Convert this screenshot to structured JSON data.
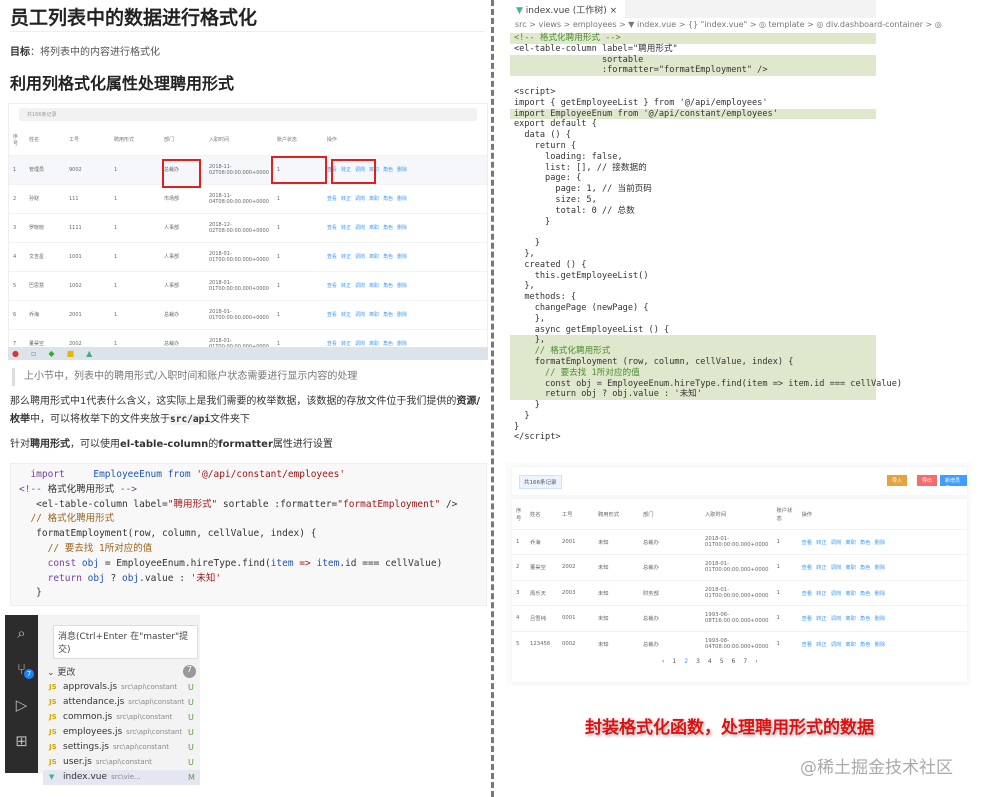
{
  "article": {
    "title": "员工列表中的数据进行格式化",
    "goal_label": "目标",
    "goal_text": "：将列表中的内容进行格式化",
    "subtitle": "利用列格式化属性处理聘用形式",
    "quote": "上小节中，列表中的聘用形式/入职时间和账户状态需要进行显示内容的处理",
    "para1_a": "那么聘用形式中1代表什么含义，这实际上是我们需要的枚举数据，该数据的存放文件位于我们提供的",
    "para1_b": "资源/枚举",
    "para1_c": "中，可以将枚举下的文件夹放于",
    "para1_code": "src/api",
    "para1_d": "文件夹下",
    "para2_a": "针对",
    "para2_b": "聘用形式",
    "para2_c": "，可以使用",
    "para2_d": "el-table-column",
    "para2_e": "的",
    "para2_f": "formatter",
    "para2_g": "属性进行设置"
  },
  "left_table": {
    "record_text": "共166条记录",
    "headers": [
      "序号",
      "姓名",
      "工号",
      "聘用形式",
      "部门",
      "入职时间",
      "账户状态",
      "操作"
    ],
    "rows": [
      [
        "1",
        "管理员",
        "9002",
        "1",
        "总裁办",
        "2018-11-02T08:00:00.000+0000",
        "1"
      ],
      [
        "2",
        "孙财",
        "111",
        "1",
        "市场部",
        "2018-11-04T08:00:00.000+0000",
        "1"
      ],
      [
        "3",
        "罗晓晓",
        "1111",
        "1",
        "人事部",
        "2018-12-02T08:00:00.000+0000",
        "1"
      ],
      [
        "4",
        "文吉星",
        "1001",
        "1",
        "人事部",
        "2018-01-01T00:00:00.000+0000",
        "1"
      ],
      [
        "5",
        "巴思慧",
        "1002",
        "1",
        "人事部",
        "2018-01-01T00:00:00.000+0000",
        "1"
      ],
      [
        "6",
        "乔海",
        "2001",
        "1",
        "总裁办",
        "2018-01-01T00:00:00.000+0000",
        "1"
      ],
      [
        "7",
        "董昊空",
        "2002",
        "1",
        "总裁办",
        "2018-01-01T00:00:00.000+0000",
        "1"
      ]
    ],
    "ops": [
      "查看",
      "转正",
      "调岗",
      "离职",
      "角色",
      "删除"
    ]
  },
  "code_block": [
    [
      [
        "  import     ",
        "kw"
      ],
      [
        "EmployeeEnum ",
        "bl"
      ],
      [
        "from ",
        "bl"
      ],
      [
        "'@/api/constant/employees'",
        "st"
      ]
    ],
    [
      [
        "<!-- ",
        "tg"
      ],
      [
        "格式化聘用形式",
        "fn"
      ],
      [
        " -->",
        "tg"
      ]
    ],
    [
      [
        "   <el-table-column label=",
        "fn"
      ],
      [
        "\"聘用形式\"",
        "st"
      ],
      [
        " sortable :formatter=",
        "fn"
      ],
      [
        "\"formatEmployment\"",
        "st"
      ],
      [
        " />",
        "fn"
      ]
    ],
    [
      [
        "  // 格式化聘用形式",
        "cm"
      ]
    ],
    [
      [
        "   formatEmployment(row, column, cellValue, index) {",
        "fn"
      ]
    ],
    [
      [
        "     // 要去找 1所对应的值",
        "cm"
      ]
    ],
    [
      [
        "     const ",
        "kw"
      ],
      [
        "obj",
        "bl"
      ],
      [
        " = EmployeeEnum.hireType.find(",
        "fn"
      ],
      [
        "item",
        "bl"
      ],
      [
        " => ",
        "st"
      ],
      [
        "item",
        "bl"
      ],
      [
        ".id === cellValue)",
        "fn"
      ]
    ],
    [
      [
        "     return ",
        "kw"
      ],
      [
        "obj",
        "bl"
      ],
      [
        " ? ",
        "fn"
      ],
      [
        "obj",
        "bl"
      ],
      [
        ".value : ",
        "fn"
      ],
      [
        "'未知'",
        "st"
      ]
    ],
    [
      [
        "   }",
        "fn"
      ]
    ]
  ],
  "scm": {
    "message_placeholder": "消息(Ctrl+Enter 在\"master\"提交)",
    "changes_label": "更改",
    "changes_count": "7",
    "activity_badge": "7",
    "files": [
      {
        "icon": "JS",
        "name": "approvals.js",
        "path": "src\\api\\constant",
        "status": "U"
      },
      {
        "icon": "JS",
        "name": "attendance.js",
        "path": "src\\api\\constant",
        "status": "U"
      },
      {
        "icon": "JS",
        "name": "common.js",
        "path": "src\\api\\constant",
        "status": "U"
      },
      {
        "icon": "JS",
        "name": "employees.js",
        "path": "src\\api\\constant",
        "status": "U"
      },
      {
        "icon": "JS",
        "name": "settings.js",
        "path": "src\\api\\constant",
        "status": "U"
      },
      {
        "icon": "JS",
        "name": "user.js",
        "path": "src\\api\\constant",
        "status": "U"
      },
      {
        "icon": "V",
        "name": "index.vue",
        "path": "src\\vie...",
        "status": "M"
      }
    ]
  },
  "editor": {
    "tab_label": "index.vue (工作树)",
    "breadcrumb": "src > views > employees > ▼ index.vue > {} \"index.vue\" > ◎ template > ◎ div.dashboard-container > ◎",
    "lines": [
      {
        "t": "<!-- 格式化聘用形式 -->",
        "hl": true,
        "c": true
      },
      {
        "t": "<el-table-column label=\"聘用形式\"",
        "hl": false
      },
      {
        "t": "                 sortable",
        "hl": true
      },
      {
        "t": "                 :formatter=\"formatEmployment\" />",
        "hl": true
      },
      {
        "t": "",
        "hl": false
      },
      {
        "t": "<script>",
        "hl": false
      },
      {
        "t": "import { getEmployeeList } from '@/api/employees'",
        "hl": false
      },
      {
        "t": "import EmployeeEnum from '@/api/constant/employees'",
        "hl": true
      },
      {
        "t": "export default {",
        "hl": false
      },
      {
        "t": "  data () {",
        "hl": false
      },
      {
        "t": "    return {",
        "hl": false
      },
      {
        "t": "      loading: false,",
        "hl": false
      },
      {
        "t": "      list: [], // 接数据的",
        "hl": false
      },
      {
        "t": "      page: {",
        "hl": false
      },
      {
        "t": "        page: 1, // 当前页码",
        "hl": false
      },
      {
        "t": "        size: 5,",
        "hl": false
      },
      {
        "t": "        total: 0 // 总数",
        "hl": false
      },
      {
        "t": "      }",
        "hl": false
      },
      {
        "t": "",
        "hl": false
      },
      {
        "t": "    }",
        "hl": false
      },
      {
        "t": "  },",
        "hl": false
      },
      {
        "t": "  created () {",
        "hl": false
      },
      {
        "t": "    this.getEmployeeList()",
        "hl": false
      },
      {
        "t": "  },",
        "hl": false
      },
      {
        "t": "  methods: {",
        "hl": false
      },
      {
        "t": "    changePage (newPage) {",
        "hl": false
      },
      {
        "t": "    },",
        "hl": false
      },
      {
        "t": "    async getEmployeeList () {",
        "hl": false
      },
      {
        "t": "    },",
        "hl": true
      },
      {
        "t": "    // 格式化聘用形式",
        "hl": true,
        "c": true
      },
      {
        "t": "    formatEmployment (row, column, cellValue, index) {",
        "hl": true
      },
      {
        "t": "      // 要去找 1所对应的值",
        "hl": true,
        "c": true
      },
      {
        "t": "      const obj = EmployeeEnum.hireType.find(item => item.id === cellValue)",
        "hl": true
      },
      {
        "t": "      return obj ? obj.value : '未知'",
        "hl": true
      },
      {
        "t": "    }",
        "hl": false
      },
      {
        "t": "  }",
        "hl": false
      },
      {
        "t": "}",
        "hl": false
      },
      {
        "t": "</script>",
        "hl": false
      }
    ]
  },
  "result_page": {
    "record_text": "共166条记录",
    "btn_import": "导入",
    "btn_export": "导出",
    "btn_add": "新增员工",
    "headers": [
      "序号",
      "姓名",
      "工号",
      "聘用形式",
      "部门",
      "入职时间",
      "账户状态",
      "操作"
    ],
    "rows": [
      [
        "1",
        "乔海",
        "2001",
        "未知",
        "总裁办",
        "2018-01-01T00:00:00.000+0000",
        "1"
      ],
      [
        "2",
        "董昊空",
        "2002",
        "未知",
        "总裁办",
        "2018-01-01T00:00:00.000+0000",
        "1"
      ],
      [
        "3",
        "周乐天",
        "2003",
        "未知",
        "财务部",
        "2018-01-01T00:00:00.000+0000",
        "1"
      ],
      [
        "4",
        "吕雪纯",
        "0001",
        "未知",
        "总裁办",
        "1993-06-08T16:00:00.000+0000",
        "1"
      ],
      [
        "5",
        "123456",
        "0002",
        "未知",
        "总裁办",
        "1993-08-04T08:00:00.000+0000",
        "1"
      ]
    ],
    "ops": [
      "查看",
      "转正",
      "调岗",
      "离职",
      "角色",
      "删除"
    ],
    "pages": [
      "‹",
      "1",
      "2",
      "3",
      "4",
      "5",
      "6",
      "7",
      "›"
    ],
    "current_page": "2"
  },
  "caption": "封装格式化函数，处理聘用形式的数据",
  "watermark": "@稀土掘金技术社区",
  "colors": {
    "primary": "#409eff",
    "warning": "#e6a23c",
    "danger": "#f56c6c",
    "highlight": "#dfe8cc",
    "caption": "#e01010"
  }
}
